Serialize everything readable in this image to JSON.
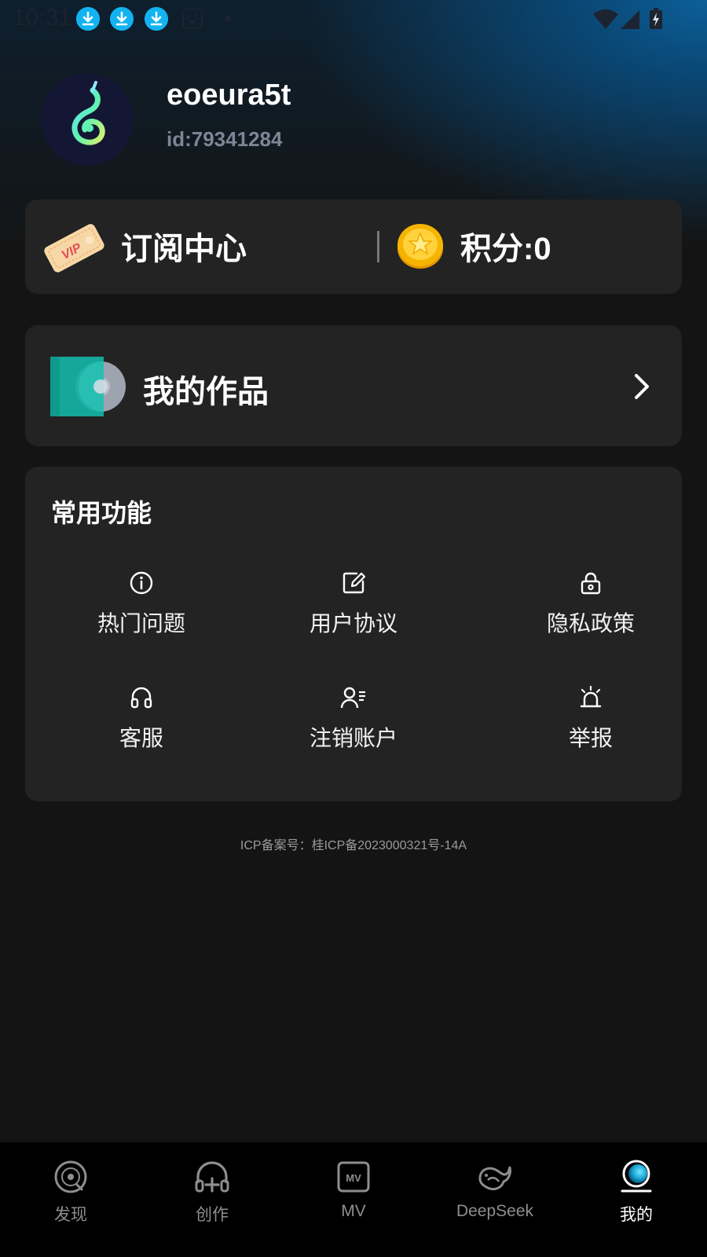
{
  "status_bar": {
    "time": "10:31",
    "icons": [
      "download-icon",
      "download-icon",
      "download-icon",
      "paw-icon",
      "wifi-icon",
      "cellular-signal-icon",
      "battery-charging-icon"
    ]
  },
  "profile": {
    "username": "eoeura5t",
    "user_id": "id:79341284",
    "avatar_icon": "music-note-logo-icon"
  },
  "subscription": {
    "label": "订阅中心",
    "vip_badge": "VIP",
    "points_label": "积分:0",
    "icons": [
      "vip-ticket-icon",
      "star-coin-icon"
    ]
  },
  "my_works": {
    "label": "我的作品",
    "icons": [
      "album-disc-icon",
      "chevron-right-icon"
    ]
  },
  "common_functions": {
    "title": "常用功能",
    "items": [
      {
        "label": "热门问题",
        "icon": "info-icon"
      },
      {
        "label": "用户协议",
        "icon": "edit-document-icon"
      },
      {
        "label": "隐私政策",
        "icon": "lock-icon"
      },
      {
        "label": "客服",
        "icon": "headphones-icon"
      },
      {
        "label": "注销账户",
        "icon": "user-list-icon"
      },
      {
        "label": "举报",
        "icon": "alarm-siren-icon"
      }
    ]
  },
  "icp": "ICP备案号：桂ICP备2023000321号-14A",
  "bottom_nav": {
    "active": "我的",
    "items": [
      {
        "label": "发现",
        "icon": "vinyl-disc-icon"
      },
      {
        "label": "创作",
        "icon": "headphones-plus-icon"
      },
      {
        "label": "MV",
        "icon": "mv-icon"
      },
      {
        "label": "DeepSeek",
        "icon": "whale-icon"
      },
      {
        "label": "我的",
        "icon": "profile-sphere-icon"
      }
    ]
  },
  "colors": {
    "background": "#141414",
    "card": "#232323",
    "accent_blue": "#0c5f99",
    "download_badge": "#12b3f0",
    "id_text": "#7d8696",
    "teal": "#18b3a8",
    "coin_gold": "#f5b400"
  }
}
